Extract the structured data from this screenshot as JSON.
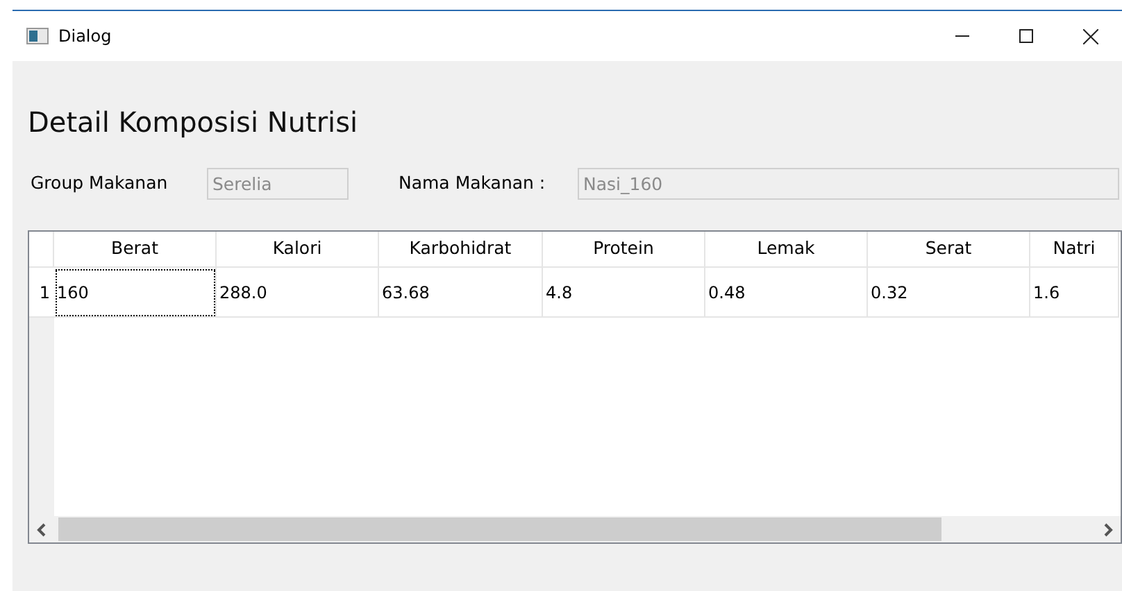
{
  "window": {
    "title": "Dialog"
  },
  "heading": "Detail Komposisi Nutrisi",
  "fields": [
    {
      "label": "Group Makanan",
      "value": "Serelia",
      "disabled": true
    },
    {
      "label": "Nama Makanan :",
      "value": "Nasi_160",
      "disabled": true
    }
  ],
  "table": {
    "columns": [
      "Berat",
      "Kalori",
      "Karbohidrat",
      "Protein",
      "Lemak",
      "Serat",
      "Natri"
    ],
    "rows": [
      {
        "header": "1",
        "cells": [
          {
            "text": "160",
            "current": true
          },
          {
            "text": "288.0",
            "current": false
          },
          {
            "text": "63.68",
            "current": false
          },
          {
            "text": "4.8",
            "current": false
          },
          {
            "text": "0.48",
            "current": false
          },
          {
            "text": "0.32",
            "current": false
          },
          {
            "text": "1.6",
            "current": false
          }
        ]
      }
    ]
  }
}
